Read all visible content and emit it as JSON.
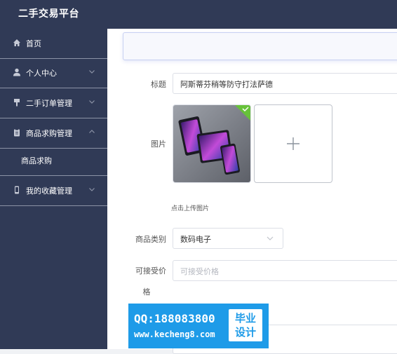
{
  "app": {
    "title": "二手交易平台"
  },
  "sidebar": {
    "items": [
      {
        "label": "首页",
        "icon": "home-icon"
      },
      {
        "label": "个人中心",
        "icon": "user-icon"
      },
      {
        "label": "二手订单管理",
        "icon": "pin-icon"
      },
      {
        "label": "商品求购管理",
        "icon": "clipboard-icon"
      },
      {
        "label": "我的收藏管理",
        "icon": "phone-icon"
      }
    ],
    "submenu": {
      "label": "商品求购"
    }
  },
  "form": {
    "title_label": "标题",
    "title_value": "阿斯蒂芬稍等防守打法萨德",
    "image_label": "图片",
    "upload_hint": "点击上传图片",
    "category_label": "商品类别",
    "category_value": "数码电子",
    "price_label_line1": "可接受价",
    "price_label_line2": "格",
    "price_placeholder": "可接受价格"
  },
  "watermark": {
    "qq": "QQ:188083800",
    "url": "www.kecheng8.com",
    "tag_line1": "毕业",
    "tag_line2": "设计"
  },
  "colors": {
    "sidebar": "#303a56",
    "accent": "#67c23a",
    "watermark": "#1e9be8"
  }
}
